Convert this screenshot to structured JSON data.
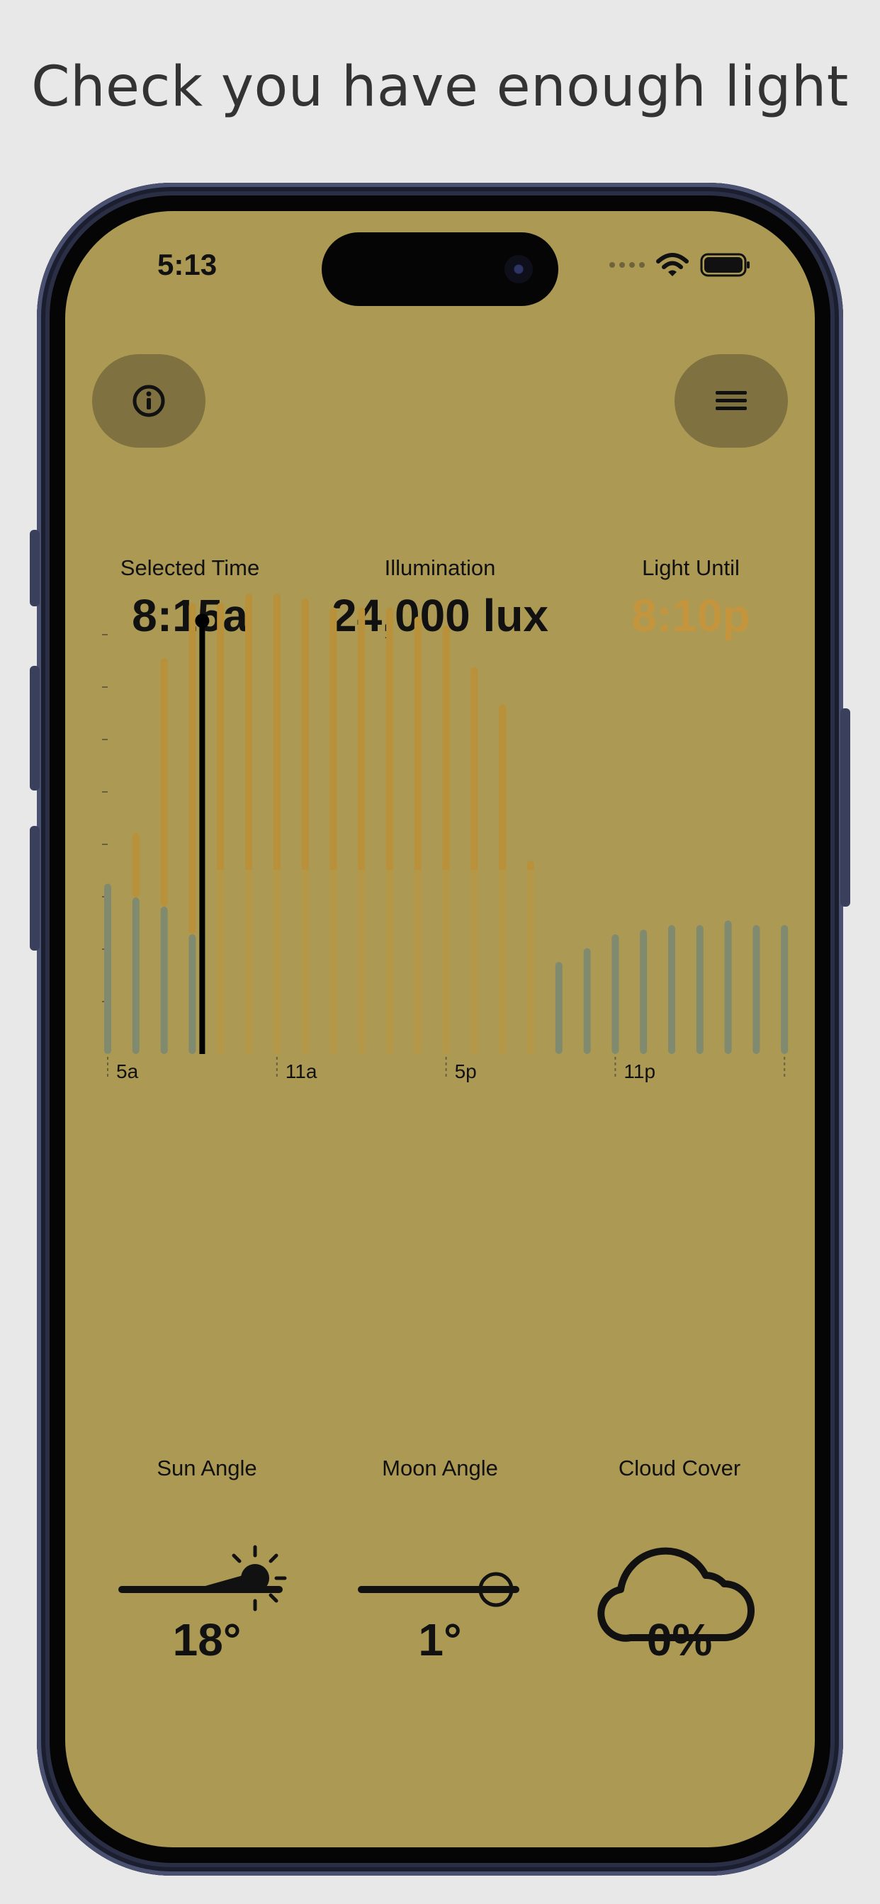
{
  "headline": "Check you have enough light",
  "status_bar": {
    "time": "5:13"
  },
  "top_bar": {
    "info_icon": "info-icon",
    "menu_icon": "hamburger-menu-icon"
  },
  "stats": [
    {
      "label": "Selected Time",
      "value": "8:15a"
    },
    {
      "label": "Illumination",
      "value": "24,000 lux"
    },
    {
      "label": "Light Until",
      "value": "8:10p"
    }
  ],
  "colors": {
    "screen_bg": "#ac9a54",
    "light_until": "#c4953c",
    "bar_day": "#b8913a",
    "bar_night": "#7f8a6f",
    "button_bg": "#7f7140"
  },
  "chart_data": {
    "type": "bar",
    "x_tick_labels": [
      "5a",
      "11a",
      "5p",
      "11p"
    ],
    "selected_index": 3,
    "bars": [
      {
        "total": 0.37,
        "night": 0.37
      },
      {
        "total": 0.48,
        "night": 0.34
      },
      {
        "total": 0.86,
        "night": 0.32
      },
      {
        "total": 0.98,
        "night": 0.26
      },
      {
        "total": 0.98,
        "night": 0.0
      },
      {
        "total": 1.0,
        "night": 0.0
      },
      {
        "total": 1.0,
        "night": 0.0
      },
      {
        "total": 0.99,
        "night": 0.0
      },
      {
        "total": 0.97,
        "night": 0.0
      },
      {
        "total": 0.97,
        "night": 0.0
      },
      {
        "total": 0.97,
        "night": 0.0
      },
      {
        "total": 0.95,
        "night": 0.0
      },
      {
        "total": 0.93,
        "night": 0.0
      },
      {
        "total": 0.84,
        "night": 0.0
      },
      {
        "total": 0.76,
        "night": 0.0
      },
      {
        "total": 0.42,
        "night": 0.0
      },
      {
        "total": 0.2,
        "night": 0.2
      },
      {
        "total": 0.23,
        "night": 0.23
      },
      {
        "total": 0.26,
        "night": 0.26
      },
      {
        "total": 0.27,
        "night": 0.27
      },
      {
        "total": 0.28,
        "night": 0.28
      },
      {
        "total": 0.28,
        "night": 0.28
      },
      {
        "total": 0.29,
        "night": 0.29
      },
      {
        "total": 0.28,
        "night": 0.28
      },
      {
        "total": 0.28,
        "night": 0.28
      }
    ]
  },
  "bottom_stats": [
    {
      "label": "Sun Angle",
      "value": "18°",
      "icon": "sun-angle-icon"
    },
    {
      "label": "Moon Angle",
      "value": "1°",
      "icon": "moon-angle-icon"
    },
    {
      "label": "Cloud Cover",
      "value": "0%",
      "icon": "cloud-icon"
    }
  ]
}
